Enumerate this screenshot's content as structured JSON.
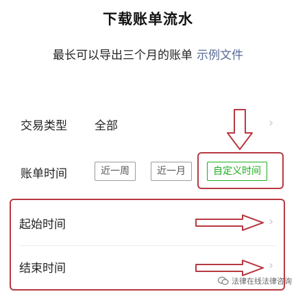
{
  "header": {
    "title": "下载账单流水",
    "subtitle_text": "最长可以导出三个月的账单",
    "subtitle_link": "示例文件"
  },
  "form": {
    "trade_type": {
      "label": "交易类型",
      "value": "全部"
    },
    "bill_time": {
      "label": "账单时间",
      "options": [
        "近一周",
        "近一月",
        "自定义时间"
      ],
      "selected": "自定义时间"
    },
    "start_time": {
      "label": "起始时间"
    },
    "end_time": {
      "label": "结束时间"
    }
  },
  "icons": {
    "chevron": "chevron-right-icon"
  },
  "annotations": {
    "arrows": [
      "arrow-down-icon",
      "arrow-right-icon",
      "arrow-right-icon"
    ],
    "color": "#b73840"
  },
  "watermark": {
    "text": "法律在线法律咨询"
  },
  "colors": {
    "accent_green": "#1aad19",
    "link_blue": "#576b95",
    "annotation_red": "#b73840"
  }
}
